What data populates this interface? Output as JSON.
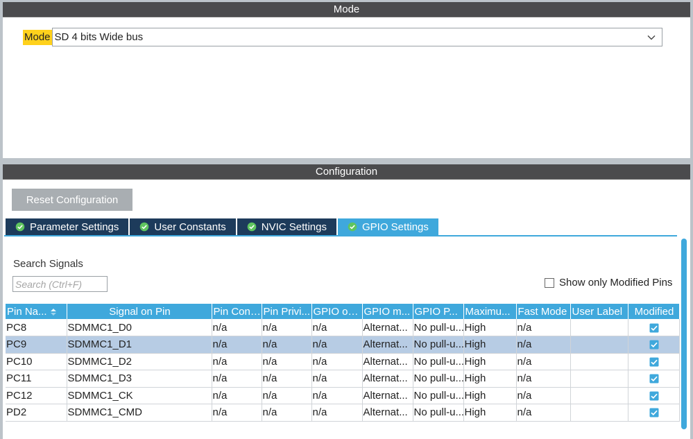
{
  "mode_panel": {
    "title": "Mode",
    "mode_label": "Mode",
    "mode_value": "SD 4 bits Wide bus"
  },
  "config_panel": {
    "title": "Configuration",
    "reset_label": "Reset Configuration",
    "tabs": [
      {
        "label": "Parameter Settings",
        "active": false
      },
      {
        "label": "User Constants",
        "active": false
      },
      {
        "label": "NVIC Settings",
        "active": false
      },
      {
        "label": "GPIO Settings",
        "active": true
      }
    ],
    "search_label": "Search Signals",
    "search_placeholder": "Search (Ctrl+F)",
    "show_modified_label": "Show only Modified Pins",
    "columns": [
      "Pin Na...",
      "Signal on Pin",
      "Pin Cont...",
      "Pin Privi...",
      "GPIO ou...",
      "GPIO m...",
      "GPIO P...",
      "Maximu...",
      "Fast Mode",
      "User Label",
      "Modified"
    ],
    "rows": [
      {
        "pin": "PC8",
        "signal": "SDMMC1_D0",
        "pin_context": "n/a",
        "pin_privilege": "n/a",
        "gpio_output": "n/a",
        "gpio_mode": "Alternat...",
        "gpio_pull": "No pull-u...",
        "max_speed": "High",
        "fast_mode": "n/a",
        "user_label": "",
        "modified": true,
        "selected": false
      },
      {
        "pin": "PC9",
        "signal": "SDMMC1_D1",
        "pin_context": "n/a",
        "pin_privilege": "n/a",
        "gpio_output": "n/a",
        "gpio_mode": "Alternat...",
        "gpio_pull": "No pull-u...",
        "max_speed": "High",
        "fast_mode": "n/a",
        "user_label": "",
        "modified": true,
        "selected": true
      },
      {
        "pin": "PC10",
        "signal": "SDMMC1_D2",
        "pin_context": "n/a",
        "pin_privilege": "n/a",
        "gpio_output": "n/a",
        "gpio_mode": "Alternat...",
        "gpio_pull": "No pull-u...",
        "max_speed": "High",
        "fast_mode": "n/a",
        "user_label": "",
        "modified": true,
        "selected": false
      },
      {
        "pin": "PC11",
        "signal": "SDMMC1_D3",
        "pin_context": "n/a",
        "pin_privilege": "n/a",
        "gpio_output": "n/a",
        "gpio_mode": "Alternat...",
        "gpio_pull": "No pull-u...",
        "max_speed": "High",
        "fast_mode": "n/a",
        "user_label": "",
        "modified": true,
        "selected": false
      },
      {
        "pin": "PC12",
        "signal": "SDMMC1_CK",
        "pin_context": "n/a",
        "pin_privilege": "n/a",
        "gpio_output": "n/a",
        "gpio_mode": "Alternat...",
        "gpio_pull": "No pull-u...",
        "max_speed": "High",
        "fast_mode": "n/a",
        "user_label": "",
        "modified": true,
        "selected": false
      },
      {
        "pin": "PD2",
        "signal": "SDMMC1_CMD",
        "pin_context": "n/a",
        "pin_privilege": "n/a",
        "gpio_output": "n/a",
        "gpio_mode": "Alternat...",
        "gpio_pull": "No pull-u...",
        "max_speed": "High",
        "fast_mode": "n/a",
        "user_label": "",
        "modified": true,
        "selected": false
      }
    ]
  },
  "colors": {
    "header_dark": "#4b4b4d",
    "tab_dark": "#1d3b5b",
    "accent_blue": "#3fa8dc",
    "selected_row": "#b7cce4",
    "mode_highlight": "#ffd11c"
  },
  "icons": {
    "tab_check": "check-circle-icon",
    "dropdown": "chevron-down-icon",
    "sort": "sort-icon",
    "modified": "checkbox-checked-icon"
  }
}
